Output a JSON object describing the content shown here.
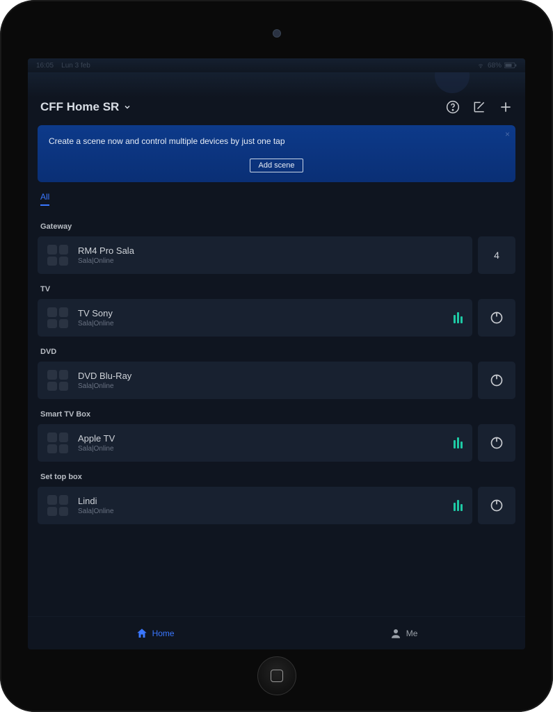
{
  "status_bar": {
    "time": "16:05",
    "date": "Lun 3 feb",
    "battery": "68%"
  },
  "header": {
    "title": "CFF Home SR"
  },
  "banner": {
    "text": "Create a scene now and control multiple devices by just one tap",
    "button": "Add scene"
  },
  "tabs": {
    "active": "All"
  },
  "sections": [
    {
      "label": "Gateway",
      "device": {
        "name": "RM4 Pro Sala",
        "sub": "Sala|Online"
      },
      "side_kind": "count",
      "side_value": "4"
    },
    {
      "label": "TV",
      "device": {
        "name": "TV Sony",
        "sub": "Sala|Online"
      },
      "show_eq": true,
      "side_kind": "power"
    },
    {
      "label": "DVD",
      "device": {
        "name": "DVD Blu-Ray",
        "sub": "Sala|Online"
      },
      "show_eq": false,
      "side_kind": "power"
    },
    {
      "label": "Smart TV Box",
      "device": {
        "name": "Apple TV",
        "sub": "Sala|Online"
      },
      "show_eq": true,
      "side_kind": "power"
    },
    {
      "label": "Set top box",
      "device": {
        "name": "Lindi",
        "sub": "Sala|Online"
      },
      "show_eq": true,
      "side_kind": "power"
    }
  ],
  "bottom_nav": {
    "home": "Home",
    "me": "Me"
  }
}
